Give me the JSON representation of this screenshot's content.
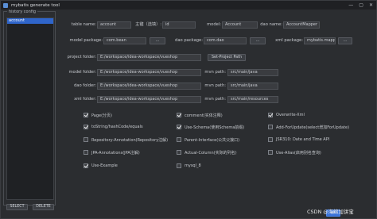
{
  "window": {
    "title": "mybatis generate tool",
    "controls": [
      "—",
      "▢",
      "✕"
    ]
  },
  "sidebar": {
    "legend": "history config",
    "items": [
      "account"
    ],
    "select_label": "SELECT",
    "delete_label": "DELETE"
  },
  "form": {
    "row1": {
      "table_name_label": "table name:",
      "table_name_value": "account",
      "pk_label": "主键（选填）:",
      "pk_value": "id",
      "model_label": "model:",
      "model_value": "Account",
      "dao_name_label": "dao name:",
      "dao_name_value": "AccountMapper"
    },
    "row2": {
      "model_package_label": "model package:",
      "model_package_value": "com.bean",
      "dao_package_label": "dao package:",
      "dao_package_value": "com.dao",
      "xml_package_label": "xml package:",
      "xml_package_value": "mybatis.mapper",
      "browse": "..."
    },
    "project": {
      "label": "project folder:",
      "value": "E:/workspace/idea-workspace/vueshop",
      "button": "Set-Project Path"
    },
    "model_path": {
      "label": "model folder:",
      "value": "E:/workspace/idea-workspace/vueshop",
      "mvn_label": "mvn path:",
      "mvn_value": "src/main/java"
    },
    "dao_path": {
      "label": "dao folder:",
      "value": "E:/workspace/idea-workspace/vueshop",
      "mvn_label": "mvn path:",
      "mvn_value": "src/main/java"
    },
    "xml_path": {
      "label": "xml folder:",
      "value": "E:/workspace/idea-workspace/vueshop",
      "mvn_label": "mvn path:",
      "mvn_value": "src/main/resources"
    }
  },
  "options": [
    {
      "label": "Page(分页)",
      "checked": true
    },
    {
      "label": "comment(实体注释)",
      "checked": true
    },
    {
      "label": "Overwrite-Xml",
      "checked": true
    },
    {
      "label": "toString/hashCode/equals",
      "checked": true
    },
    {
      "label": "Use-Schema(使用Schema前缀)",
      "checked": true
    },
    {
      "label": "Add-ForUpdate(select增加ForUpdate)",
      "checked": false
    },
    {
      "label": "Repository-Annotation(Repository注解)",
      "checked": false
    },
    {
      "label": "Parent-Interface(公共父接口)",
      "checked": false
    },
    {
      "label": "JSR310: Date and Time API",
      "checked": false
    },
    {
      "label": "JPA-Annotations(JPA注解)",
      "checked": false
    },
    {
      "label": "Actual-Column(实际的列名)",
      "checked": false
    },
    {
      "label": "Use-Alias(启用别名查询)",
      "checked": false
    },
    {
      "label": "Use-Example",
      "checked": true
    },
    {
      "label": "mysql_8",
      "checked": false
    }
  ],
  "footer": {
    "ok_label": "ok",
    "watermark": "CSDN @海绵加饼宝"
  }
}
